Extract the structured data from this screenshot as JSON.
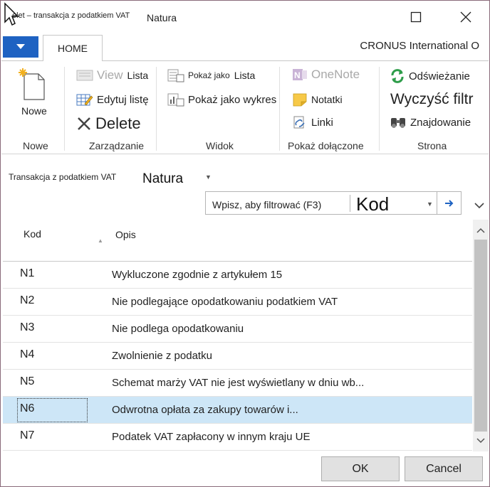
{
  "titlebar": {
    "title_prefix": "elet – transakcja z podatkiem VAT",
    "title": "Natura"
  },
  "ribbon": {
    "tab_home": "HOME",
    "company": "CRONUS International O",
    "groups": {
      "nowe": {
        "label": "Nowe",
        "new_btn": "Nowe"
      },
      "zarzadzanie": {
        "label": "Zarządzanie",
        "view": "View",
        "view_sub": "Lista",
        "edit": "Edytuj listę",
        "delete": "Delete"
      },
      "widok": {
        "label": "Widok",
        "show_as": "Pokaż jako",
        "show_as_sub": "Lista",
        "show_chart": "Pokaż jako wykres"
      },
      "pokaz": {
        "label": "Pokaż dołączone",
        "onenote": "OneNote",
        "notes": "Notatki",
        "links": "Linki"
      },
      "strona": {
        "label": "Strona",
        "refresh": "Odświeżanie",
        "clear": "Wyczyść filtr",
        "find": "Znajdowanie"
      }
    }
  },
  "page": {
    "breadcrumb_small": "Transakcja z podatkiem VAT",
    "breadcrumb_large": "Natura"
  },
  "filter": {
    "placeholder": "Wpisz, aby filtrować (F3)",
    "field": "Kod"
  },
  "grid": {
    "columns": [
      "Kod",
      "Opis"
    ],
    "selected_index": 5,
    "rows": [
      {
        "kod": "N1",
        "opis": "Wykluczone zgodnie z artykułem 15"
      },
      {
        "kod": "N2",
        "opis": "Nie podlegające opodatkowaniu podatkiem VAT"
      },
      {
        "kod": "N3",
        "opis": "Nie podlega opodatkowaniu"
      },
      {
        "kod": "N4",
        "opis": "Zwolnienie z podatku"
      },
      {
        "kod": "N5",
        "opis": "Schemat marży VAT nie jest wyświetlany w dniu wb..."
      },
      {
        "kod": "N6",
        "opis": "Odwrotna opłata za zakupy towarów i..."
      },
      {
        "kod": "N7",
        "opis": "Podatek VAT zapłacony w innym kraju UE"
      }
    ]
  },
  "footer": {
    "ok": "OK",
    "cancel": "Cancel"
  },
  "colors": {
    "accent": "#1e62c2",
    "selection": "#cde6f7",
    "refresh_green": "#2e9d4a",
    "onenote_purple": "#9b6fb3"
  }
}
